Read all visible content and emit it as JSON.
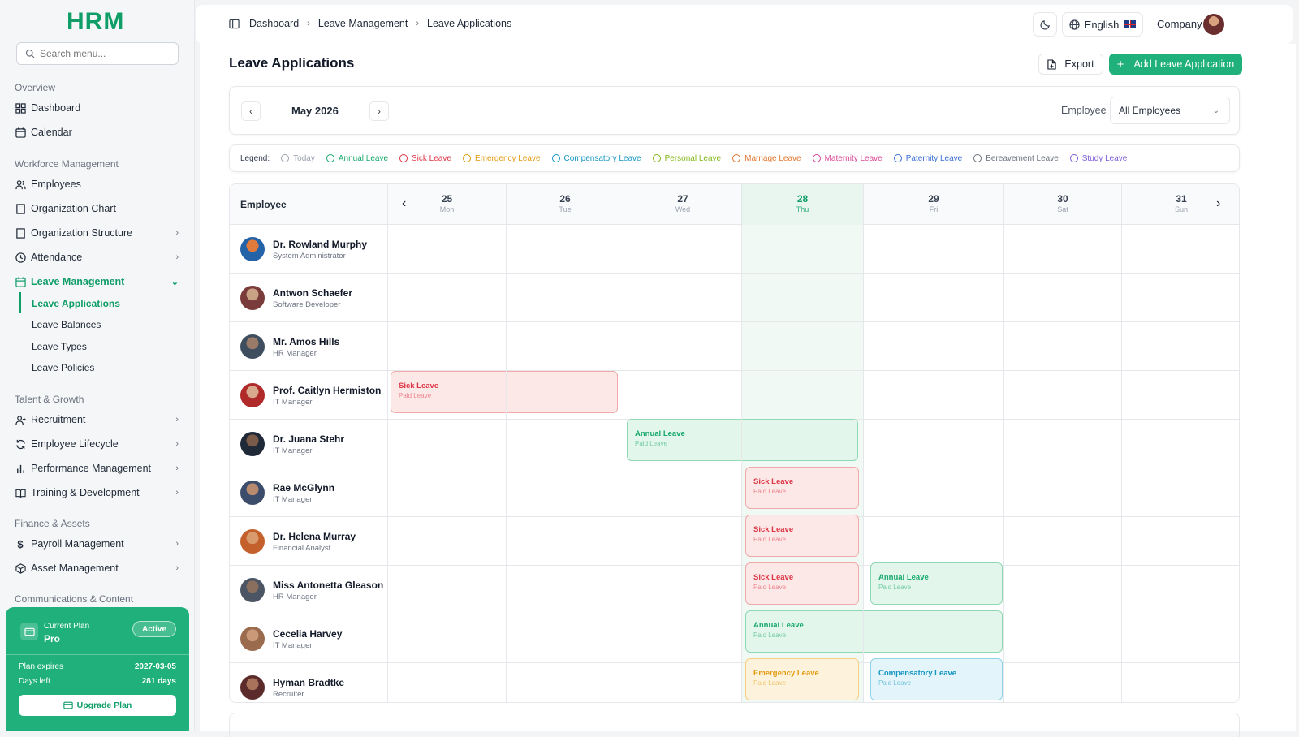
{
  "app": {
    "logo": "HRM"
  },
  "sidebar": {
    "search_placeholder": "Search menu...",
    "sections": {
      "overview": "Overview",
      "workforce": "Workforce Management",
      "talent": "Talent & Growth",
      "finance": "Finance & Assets",
      "comms": "Communications & Content"
    },
    "items": {
      "dashboard": "Dashboard",
      "calendar": "Calendar",
      "employees": "Employees",
      "org_chart": "Organization Chart",
      "org_structure": "Organization Structure",
      "attendance": "Attendance",
      "leave_management": "Leave Management",
      "recruitment": "Recruitment",
      "lifecycle": "Employee Lifecycle",
      "performance": "Performance Management",
      "training": "Training & Development",
      "payroll": "Payroll Management",
      "asset": "Asset Management"
    },
    "leave_sub": [
      "Leave Applications",
      "Leave Balances",
      "Leave Types",
      "Leave Policies"
    ],
    "plan": {
      "label": "Current Plan",
      "name": "Pro",
      "badge": "Active",
      "expires_label": "Plan expires",
      "expires_value": "2027-03-05",
      "days_label": "Days left",
      "days_value": "281 days",
      "upgrade": "Upgrade Plan"
    }
  },
  "topbar": {
    "breadcrumb": [
      "Dashboard",
      "Leave Management",
      "Leave Applications"
    ],
    "language": "English",
    "company": "Company"
  },
  "page": {
    "title": "Leave Applications",
    "export": "Export",
    "add": "Add Leave Application",
    "month": "May 2026",
    "employee_filter_label": "Employee",
    "employee_filter_value": "All Employees"
  },
  "legend": {
    "title": "Legend:",
    "items": [
      {
        "label": "Today",
        "color": "#9ca3af"
      },
      {
        "label": "Annual Leave",
        "color": "#17a86b"
      },
      {
        "label": "Sick Leave",
        "color": "#dc3545"
      },
      {
        "label": "Emergency Leave",
        "color": "#e39a10"
      },
      {
        "label": "Compensatory Leave",
        "color": "#1596c2"
      },
      {
        "label": "Personal Leave",
        "color": "#84b81a"
      },
      {
        "label": "Marriage Leave",
        "color": "#e4762d"
      },
      {
        "label": "Maternity Leave",
        "color": "#d94696"
      },
      {
        "label": "Paternity Leave",
        "color": "#3b6fd6"
      },
      {
        "label": "Bereavement Leave",
        "color": "#6b7280"
      },
      {
        "label": "Study Leave",
        "color": "#7c5bd6"
      }
    ]
  },
  "calendar": {
    "employee_header": "Employee",
    "days": [
      {
        "num": "25",
        "dow": "Mon"
      },
      {
        "num": "26",
        "dow": "Tue"
      },
      {
        "num": "27",
        "dow": "Wed"
      },
      {
        "num": "28",
        "dow": "Thu"
      },
      {
        "num": "29",
        "dow": "Fri"
      },
      {
        "num": "30",
        "dow": "Sat"
      },
      {
        "num": "31",
        "dow": "Sun"
      }
    ],
    "employees": [
      {
        "name": "Dr. Rowland Murphy",
        "role": "System Administrator"
      },
      {
        "name": "Antwon Schaefer",
        "role": "Software Developer"
      },
      {
        "name": "Mr. Amos Hills",
        "role": "HR Manager"
      },
      {
        "name": "Prof. Caitlyn Hermiston",
        "role": "IT Manager"
      },
      {
        "name": "Dr. Juana Stehr",
        "role": "IT Manager"
      },
      {
        "name": "Rae McGlynn",
        "role": "IT Manager"
      },
      {
        "name": "Dr. Helena Murray",
        "role": "Financial Analyst"
      },
      {
        "name": "Miss Antonetta Gleason",
        "role": "HR Manager"
      },
      {
        "name": "Cecelia Harvey",
        "role": "IT Manager"
      },
      {
        "name": "Hyman Bradtke",
        "role": "Recruiter"
      }
    ],
    "leaves": {
      "caitlyn_sick": {
        "type": "Sick Leave",
        "pay": "Paid Leave"
      },
      "juana_annual": {
        "type": "Annual Leave",
        "pay": "Paid Leave"
      },
      "rae_sick": {
        "type": "Sick Leave",
        "pay": "Paid Leave"
      },
      "helena_sick": {
        "type": "Sick Leave",
        "pay": "Paid Leave"
      },
      "antonetta_sick": {
        "type": "Sick Leave",
        "pay": "Paid Leave"
      },
      "antonetta_annual": {
        "type": "Annual Leave",
        "pay": "Paid Leave"
      },
      "cecelia_annual": {
        "type": "Annual Leave",
        "pay": "Paid Leave"
      },
      "hyman_emergency": {
        "type": "Emergency Leave",
        "pay": "Paid Leave"
      },
      "hyman_comp": {
        "type": "Compensatory Leave",
        "pay": "Paid Leave"
      }
    }
  }
}
